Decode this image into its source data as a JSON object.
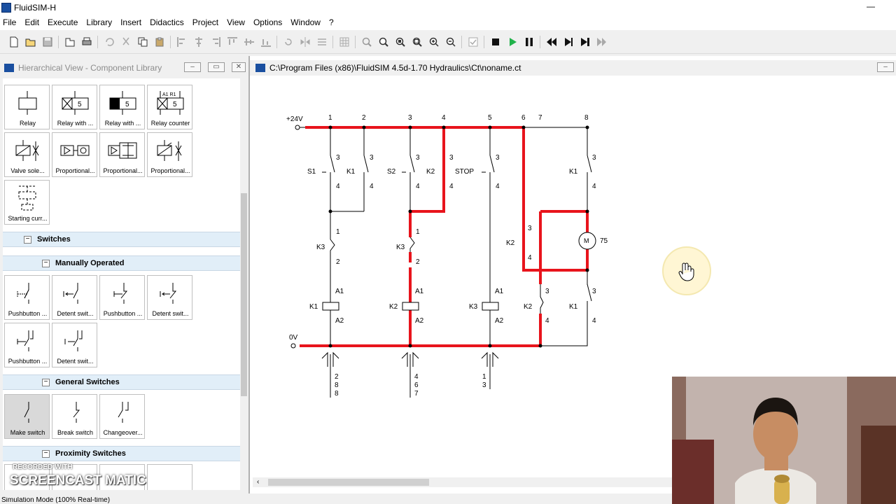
{
  "app": {
    "title": "FluidSIM-H"
  },
  "menu": [
    "File",
    "Edit",
    "Execute",
    "Library",
    "Insert",
    "Didactics",
    "Project",
    "View",
    "Options",
    "Window",
    "?"
  ],
  "library": {
    "title": "Hierarchical View - Component Library",
    "relays": [
      {
        "label": "Relay"
      },
      {
        "label": "Relay with ..."
      },
      {
        "label": "Relay with ..."
      },
      {
        "label": "Relay counter"
      },
      {
        "label": "Valve sole..."
      },
      {
        "label": "Proportional..."
      },
      {
        "label": "Proportional..."
      },
      {
        "label": "Proportional..."
      },
      {
        "label": "Starting curr..."
      }
    ],
    "categories": {
      "switches": "Switches",
      "manually_operated": "Manually Operated",
      "general_switches": "General Switches",
      "proximity_switches": "Proximity Switches"
    },
    "manual_switches": [
      {
        "label": "Pushbutton ..."
      },
      {
        "label": "Detent swit..."
      },
      {
        "label": "Pushbutton ..."
      },
      {
        "label": "Detent swit..."
      },
      {
        "label": "Pushbutton ..."
      },
      {
        "label": "Detent swit..."
      }
    ],
    "general_switches": [
      {
        "label": "Make switch"
      },
      {
        "label": "Break switch"
      },
      {
        "label": "Changeover..."
      }
    ]
  },
  "diagram": {
    "title": "C:\\Program Files (x86)\\FluidSIM 4.5d-1.70 Hydraulics\\Ct\\noname.ct",
    "supply_plus": "+24V",
    "supply_zero": "0V",
    "column_numbers": [
      "1",
      "2",
      "3",
      "4",
      "5",
      "6",
      "7",
      "8"
    ],
    "labels": {
      "s1": "S1",
      "k1_a": "K1",
      "s2": "S2",
      "k2_a": "K2",
      "stop": "STOP",
      "k1_b": "K1",
      "k3_a": "K3",
      "k3_b": "K3",
      "k2_b": "K2",
      "k1_coil": "K1",
      "k2_coil": "K2",
      "k3_coil": "K3",
      "k2_c": "K2",
      "k1_c": "K1",
      "motor": "M",
      "motor_value": "75",
      "t3": "3",
      "t4": "4",
      "t1": "1",
      "t2": "2",
      "a1": "A1",
      "a2": "A2"
    },
    "contact_tables": [
      [
        "2",
        "8",
        "8"
      ],
      [
        "4",
        "6",
        "7"
      ],
      [
        "1",
        "3"
      ]
    ]
  },
  "status": "Simulation Mode (100% Real-time)",
  "watermark": {
    "line1": "RECORDED WITH",
    "line2": "SCREENCAST   MATIC"
  },
  "colors": {
    "active_wire": "#e8141c",
    "wire": "#000000",
    "category_bg": "#e1eef8",
    "brand_blue": "#1a4fa0"
  }
}
